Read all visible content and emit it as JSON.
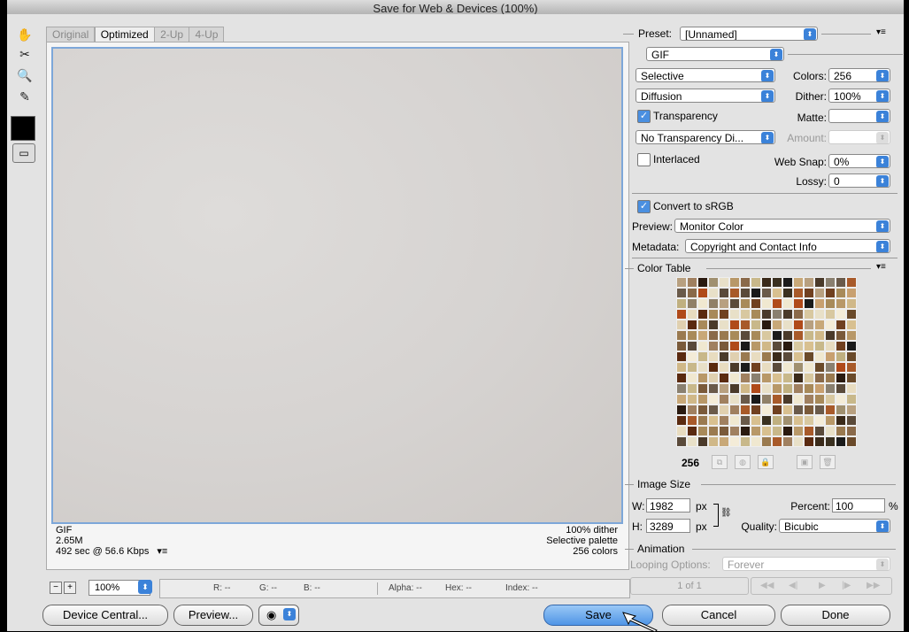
{
  "window": {
    "title": "Save for Web & Devices (100%)"
  },
  "tabs": [
    "Original",
    "Optimized",
    "2-Up",
    "4-Up"
  ],
  "active_tab": "Optimized",
  "image_info": {
    "format": "GIF",
    "size": "2.65M",
    "download": "492 sec @ 56.6 Kbps",
    "dither": "100% dither",
    "palette": "Selective palette",
    "colors": "256 colors"
  },
  "status": {
    "zoom": "100%",
    "r": "R: --",
    "g": "G: --",
    "b": "B: --",
    "alpha": "Alpha: --",
    "hex": "Hex: --",
    "index": "Index: --"
  },
  "footer": {
    "device_central": "Device Central...",
    "preview": "Preview...",
    "save": "Save",
    "cancel": "Cancel",
    "done": "Done"
  },
  "settings": {
    "preset_label": "Preset:",
    "preset_value": "[Unnamed]",
    "format": "GIF",
    "reduction": "Selective",
    "colors_label": "Colors:",
    "colors_value": "256",
    "dither_algo": "Diffusion",
    "dither_label": "Dither:",
    "dither_value": "100%",
    "transparency_label": "Transparency",
    "matte_label": "Matte:",
    "transparency_dither": "No Transparency Di...",
    "amount_label": "Amount:",
    "interlaced_label": "Interlaced",
    "websnap_label": "Web Snap:",
    "websnap_value": "0%",
    "lossy_label": "Lossy:",
    "lossy_value": "0",
    "convert_label": "Convert to sRGB",
    "preview_label": "Preview:",
    "preview_value": "Monitor Color",
    "metadata_label": "Metadata:",
    "metadata_value": "Copyright and Contact Info"
  },
  "color_table": {
    "title": "Color Table",
    "count": "256",
    "swatches": [
      "#8a6a4a",
      "#5a2a10",
      "#a88a5a",
      "#c8b88a",
      "#3a2a1a",
      "#b04a1a",
      "#e8dcc0",
      "#6a4a2a",
      "#d8c090",
      "#9a7a50",
      "#2a1a10",
      "#c8a878",
      "#7a5a3a",
      "#b89868",
      "#f0e8d0",
      "#4a3a2a",
      "#a85a2a",
      "#c8a070",
      "#f4ecd8",
      "#5a4a3a",
      "#1a1a1a",
      "#d8c8a0",
      "#8a8070",
      "#a08060",
      "#c0b080",
      "#3a3020",
      "#e0d0b0",
      "#704020",
      "#b8a080",
      "#908068",
      "#d0b888",
      "#6a5a4a",
      "#e8e0c8",
      "#a09070"
    ],
    "tools": [
      "⧉",
      "◍",
      "🔒",
      "▣",
      "🗑"
    ]
  },
  "image_size": {
    "title": "Image Size",
    "w_label": "W:",
    "w_value": "1982",
    "w_unit": "px",
    "h_label": "H:",
    "h_value": "3289",
    "h_unit": "px",
    "percent_label": "Percent:",
    "percent_value": "100",
    "percent_unit": "%",
    "quality_label": "Quality:",
    "quality_value": "Bicubic"
  },
  "animation": {
    "title": "Animation",
    "looping_label": "Looping Options:",
    "looping_value": "Forever",
    "frame": "1 of 1"
  }
}
